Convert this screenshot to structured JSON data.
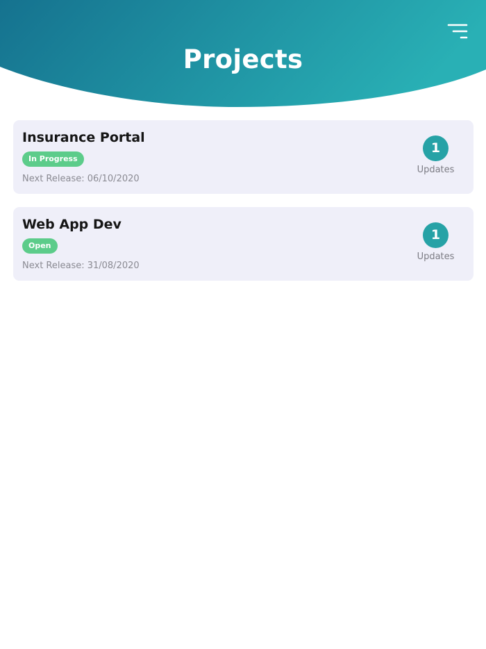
{
  "header": {
    "title": "Projects",
    "menu_icon": "filter-menu-icon",
    "gradient_start": "#15728f",
    "gradient_end": "#29b0b5"
  },
  "projects": [
    {
      "name": "Insurance Portal",
      "status": "In Progress",
      "status_color": "#5ccc8a",
      "next_release": "Next Release: 06/10/2020",
      "updates_count": "1",
      "updates_label": "Updates",
      "updates_color": "#26a2a6"
    },
    {
      "name": "Web App Dev",
      "status": "Open",
      "status_color": "#5ccc8a",
      "next_release": "Next Release: 31/08/2020",
      "updates_count": "1",
      "updates_label": "Updates",
      "updates_color": "#26a2a6"
    }
  ],
  "colors": {
    "card_background": "#efeff9",
    "page_background": "#ffffff"
  }
}
